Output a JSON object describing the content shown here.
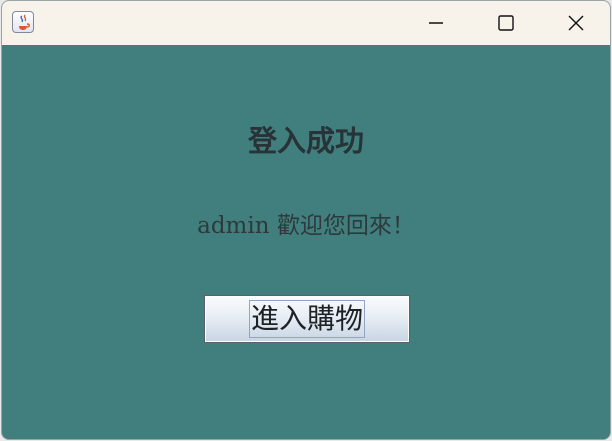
{
  "window": {
    "title": "",
    "controls": {
      "minimize_icon": "minimize-icon",
      "maximize_icon": "maximize-icon",
      "close_icon": "close-icon"
    },
    "app_icon": "java-coffee-cup-icon"
  },
  "main": {
    "title": "登入成功",
    "welcome_message": "admin 歡迎您回來！",
    "enter_button_label": "進入購物"
  },
  "colors": {
    "background": "#417f7e",
    "titlebar": "#f7f3ea",
    "text": "#273337"
  }
}
